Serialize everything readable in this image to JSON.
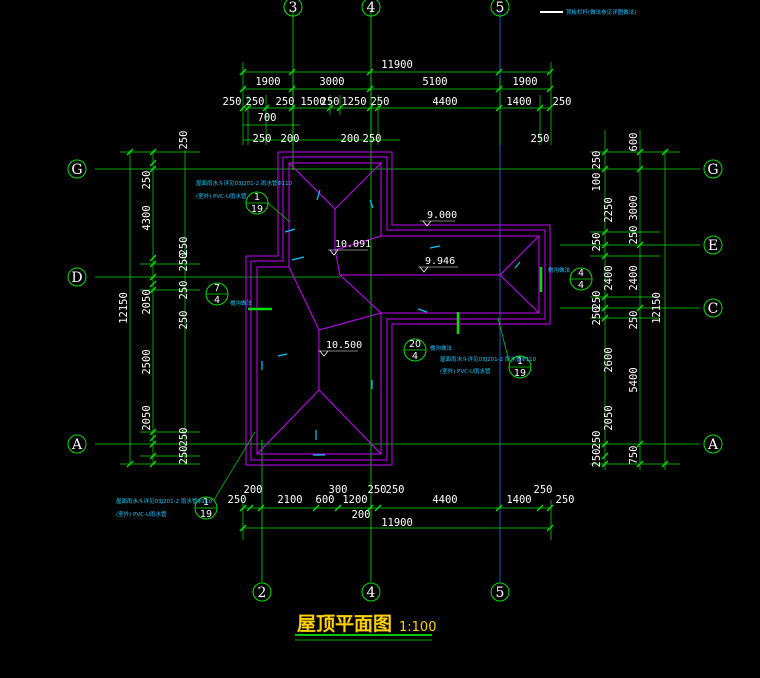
{
  "title": {
    "text": "屋顶平面图",
    "scale": "1:100"
  },
  "top_note": "顶板栏杆(做法参见详图做法)",
  "grid_axes": {
    "vertical_top": [
      "3",
      "4",
      "5"
    ],
    "vertical_bottom": [
      "2",
      "4",
      "5"
    ],
    "horizontal": [
      "G",
      "E",
      "D",
      "C",
      "A"
    ]
  },
  "dims_top": {
    "total": "11900",
    "row1": [
      "1900",
      "3000",
      "5100",
      "1900"
    ],
    "row2": [
      "250",
      "250",
      "250",
      "1500",
      "250",
      "1250",
      "250",
      "4400",
      "1400",
      "250"
    ],
    "row3": [
      "700",
      "250",
      "200",
      "200",
      "250",
      "250"
    ]
  },
  "dims_bottom": {
    "total": "11900",
    "row1": [
      "250",
      "200",
      "2100",
      "300",
      "600",
      "1200",
      "250",
      "250",
      "4400",
      "1400",
      "250",
      "250"
    ],
    "row2": [
      "200"
    ]
  },
  "dims_left": {
    "total": "12150",
    "row1": [
      "4300",
      "2050",
      "2500",
      "2050"
    ],
    "row2": [
      "250",
      "250",
      "250",
      "250",
      "250",
      "250",
      "250",
      "250"
    ]
  },
  "dims_right": {
    "total": "12150",
    "row1": [
      "3000",
      "2400",
      "5400",
      "750"
    ],
    "row2": [
      "600",
      "2250",
      "250",
      "2400",
      "250",
      "2600",
      "2050"
    ],
    "row3": [
      "250",
      "100",
      "250",
      "250",
      "250",
      "250",
      "250"
    ]
  },
  "elevations": [
    "9.000",
    "10.091",
    "9.946",
    "10.500"
  ],
  "details": [
    {
      "num": "1",
      "den": "19"
    },
    {
      "num": "7",
      "den": "4"
    },
    {
      "num": "4",
      "den": "4"
    },
    {
      "num": "20",
      "den": "4"
    },
    {
      "num": "1",
      "den": "19"
    },
    {
      "num": "1",
      "den": "19"
    }
  ],
  "notes": {
    "downpipe_a": "屋面雨水斗详见03J201-2 雨水管Φ110",
    "downpipe_b": "(室外) PVC-U雨水管",
    "gutter": "檐沟做法"
  },
  "colors": {
    "background": "#000000",
    "grid_line": "#00ff00",
    "roof_outline": "#c800ff",
    "dimension_text": "#ffffff",
    "title": "#ffd200",
    "note_text": "#19c8ff",
    "slope_arrow": "#00c8ff"
  }
}
